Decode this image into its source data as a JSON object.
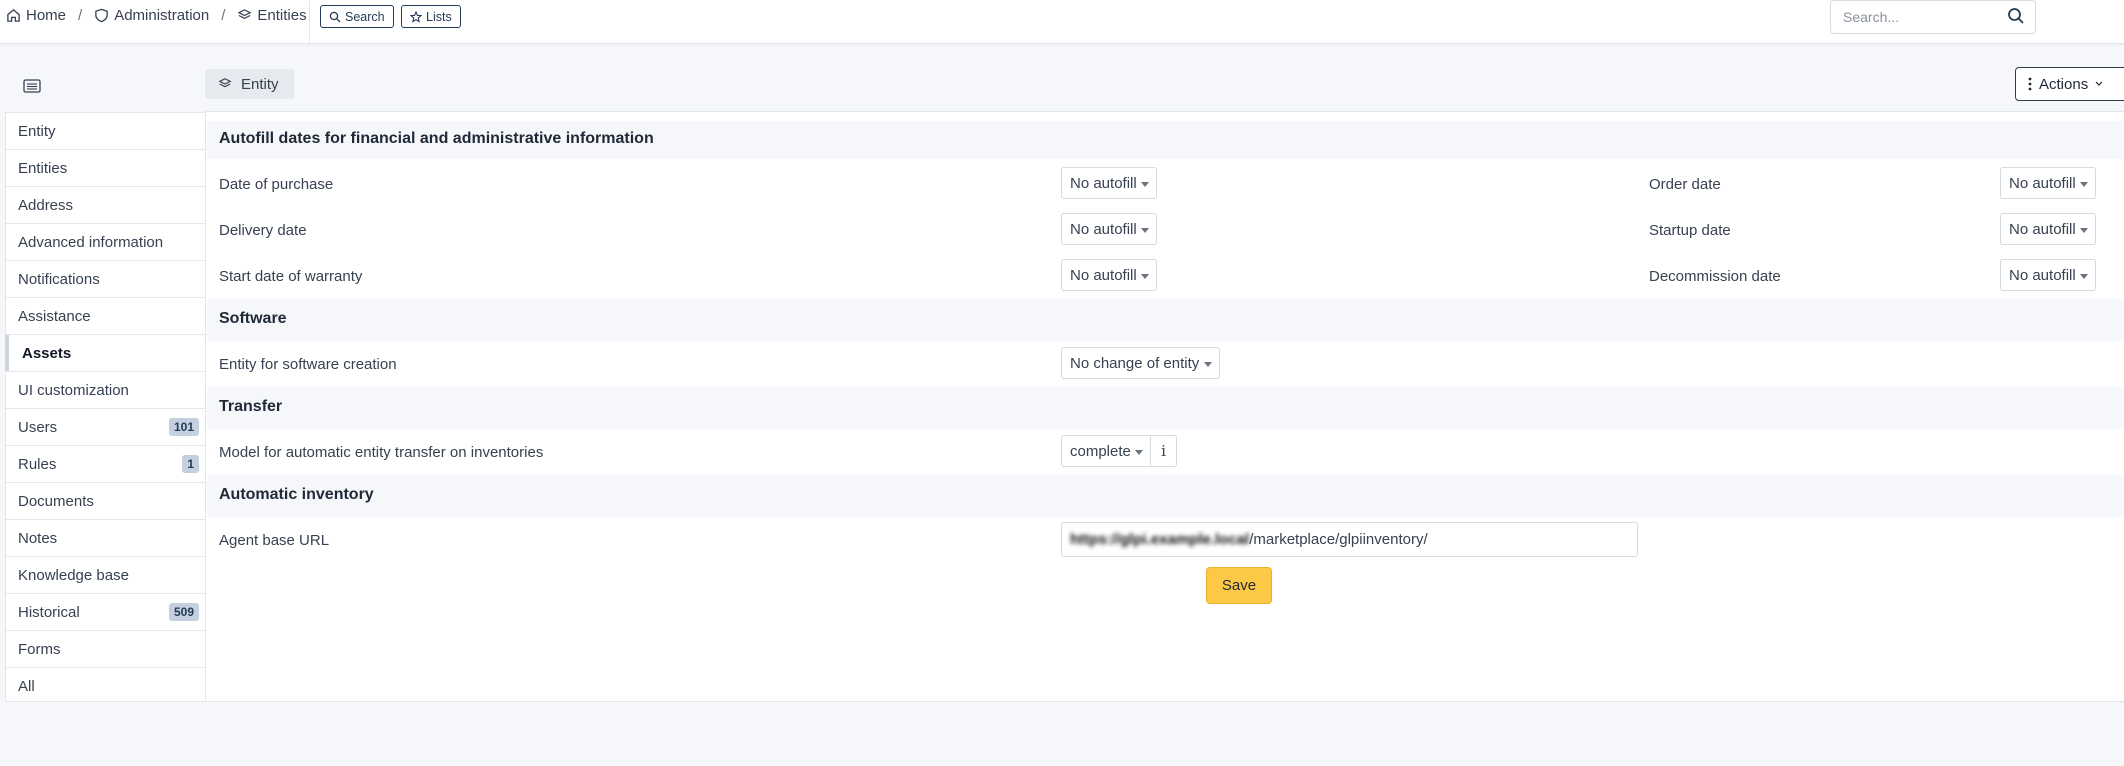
{
  "breadcrumb": {
    "home": "Home",
    "separator": "/",
    "administration": "Administration",
    "entities": "Entities"
  },
  "toolbar": {
    "search_label": "Search",
    "lists_label": "Lists"
  },
  "global_search": {
    "placeholder": "Search..."
  },
  "tab": {
    "label": "Entity"
  },
  "actions": {
    "label": "Actions"
  },
  "sidebar": {
    "items": [
      {
        "label": "Entity"
      },
      {
        "label": "Entities"
      },
      {
        "label": "Address"
      },
      {
        "label": "Advanced information"
      },
      {
        "label": "Notifications"
      },
      {
        "label": "Assistance"
      },
      {
        "label": "Assets",
        "active": true
      },
      {
        "label": "UI customization"
      },
      {
        "label": "Users",
        "badge": "101"
      },
      {
        "label": "Rules",
        "badge": "1"
      },
      {
        "label": "Documents"
      },
      {
        "label": "Notes"
      },
      {
        "label": "Knowledge base"
      },
      {
        "label": "Historical",
        "badge": "509"
      },
      {
        "label": "Forms"
      },
      {
        "label": "All"
      }
    ]
  },
  "autofill": {
    "title": "Autofill dates for financial and administrative information",
    "date_of_purchase": {
      "label": "Date of purchase",
      "value": "No autofill"
    },
    "order_date": {
      "label": "Order date",
      "value": "No autofill"
    },
    "delivery_date": {
      "label": "Delivery date",
      "value": "No autofill"
    },
    "startup_date": {
      "label": "Startup date",
      "value": "No autofill"
    },
    "start_date_warranty": {
      "label": "Start date of warranty",
      "value": "No autofill"
    },
    "decommission_date": {
      "label": "Decommission date",
      "value": "No autofill"
    }
  },
  "software": {
    "title": "Software",
    "entity_creation": {
      "label": "Entity for software creation",
      "value": "No change of entity"
    }
  },
  "transfer": {
    "title": "Transfer",
    "model": {
      "label": "Model for automatic entity transfer on inventories",
      "value": "complete",
      "info": "i"
    }
  },
  "inventory": {
    "title": "Automatic inventory",
    "agent_url": {
      "label": "Agent base URL",
      "value_redacted": "https://glpi.example.local",
      "value_suffix": "/marketplace/glpiinventory/"
    }
  },
  "save_label": "Save"
}
